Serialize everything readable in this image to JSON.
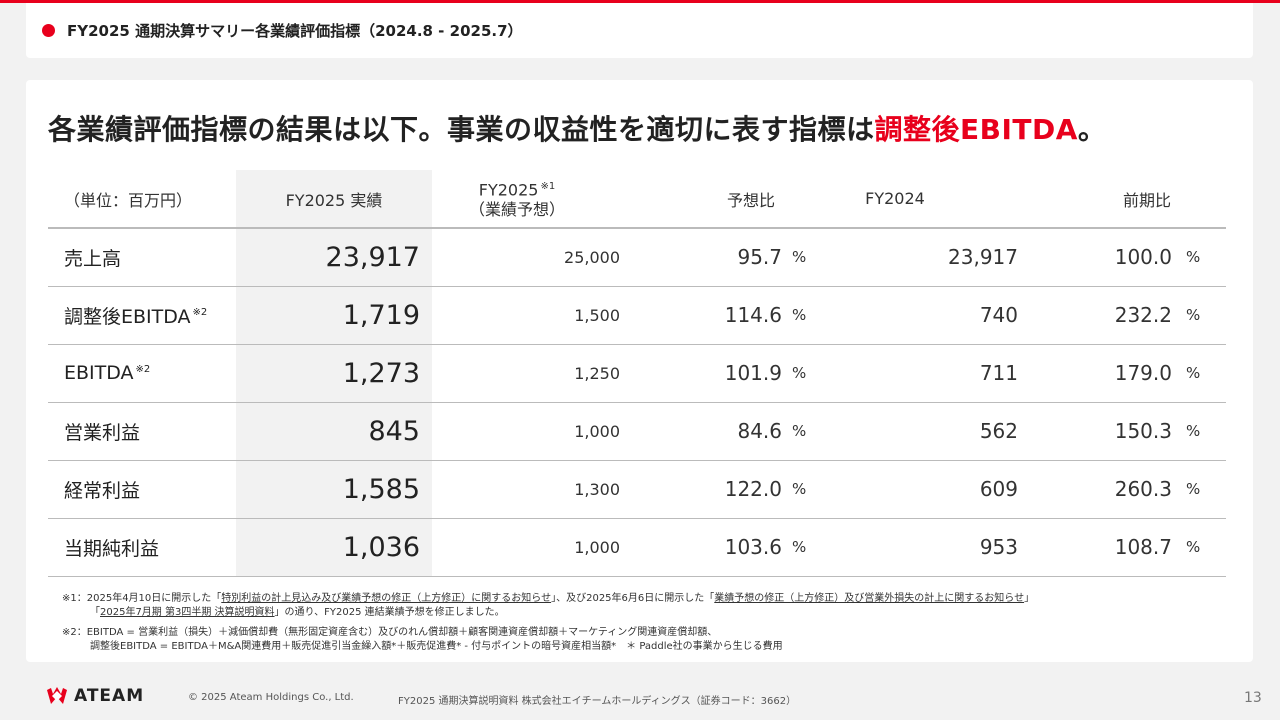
{
  "header": {
    "title": "FY2025 通期決算サマリー各業績評価指標（2024.8 - 2025.7）"
  },
  "headline": {
    "text_before": "各業績評価指標の結果は以下。事業の収益性を適切に表す指標は",
    "highlight": "調整後EBITDA",
    "text_after": "。"
  },
  "table": {
    "unit_label": "（単位：百万円）",
    "col_actual": "FY2025 実績",
    "col_plan_line1": "FY2025",
    "col_plan_note": "※1",
    "col_plan_line2": "（業績予想）",
    "col_ratio": "予想比",
    "col_prev": "FY2024",
    "col_yoy": "前期比",
    "pct": "%",
    "rows": [
      {
        "label": "売上高",
        "note": "",
        "actual": "23,917",
        "plan": "25,000",
        "ratio": "95.7",
        "prev": "23,917",
        "yoy": "100.0"
      },
      {
        "label": "調整後EBITDA",
        "note": "※2",
        "actual": "1,719",
        "plan": "1,500",
        "ratio": "114.6",
        "prev": "740",
        "yoy": "232.2"
      },
      {
        "label": "EBITDA",
        "note": "※2",
        "actual": "1,273",
        "plan": "1,250",
        "ratio": "101.9",
        "prev": "711",
        "yoy": "179.0"
      },
      {
        "label": "営業利益",
        "note": "",
        "actual": "845",
        "plan": "1,000",
        "ratio": "84.6",
        "prev": "562",
        "yoy": "150.3"
      },
      {
        "label": "経常利益",
        "note": "",
        "actual": "1,585",
        "plan": "1,300",
        "ratio": "122.0",
        "prev": "609",
        "yoy": "260.3"
      },
      {
        "label": "当期純利益",
        "note": "",
        "actual": "1,036",
        "plan": "1,000",
        "ratio": "103.6",
        "prev": "953",
        "yoy": "108.7"
      }
    ]
  },
  "footnotes": {
    "n1_prefix": "※1：2025年4月10日に開示した「",
    "n1_link1": "特別利益の計上見込み及び業績予想の修正（上方修正）に関するお知らせ",
    "n1_mid": "」、及び2025年6月6日に開示した「",
    "n1_link2": "業績予想の修正（上方修正）及び営業外損失の計上に関するお知らせ",
    "n1_end": "」",
    "n1_line2_prefix": "「",
    "n1_link3": "2025年7月期 第3四半期 決算説明資料",
    "n1_line2_suffix": "」の通り、FY2025 連結業績予想を修正しました。",
    "n2_line1": "※2：EBITDA = 営業利益（損失）＋減価償却費（無形固定資産含む）及びのれん償却額＋顧客関連資産償却額＋マーケティング関連資産償却額、",
    "n2_line2": "調整後EBITDA = EBITDA＋M&A関連費用＋販売促進引当金繰入額*＋販売促進費* - 付与ポイントの暗号資産相当額*　＊ Paddle社の事業から生じる費用"
  },
  "footer": {
    "logo_text": "ATEAM",
    "copyright": "© 2025 Ateam Holdings Co., Ltd.",
    "docname": "FY2025 通期決算説明資料 株式会社エイチームホールディングス（証券コード：3662）",
    "page": "13"
  },
  "colors": {
    "accent": "#e8001c",
    "actual_bg": "#f2f2f2"
  }
}
